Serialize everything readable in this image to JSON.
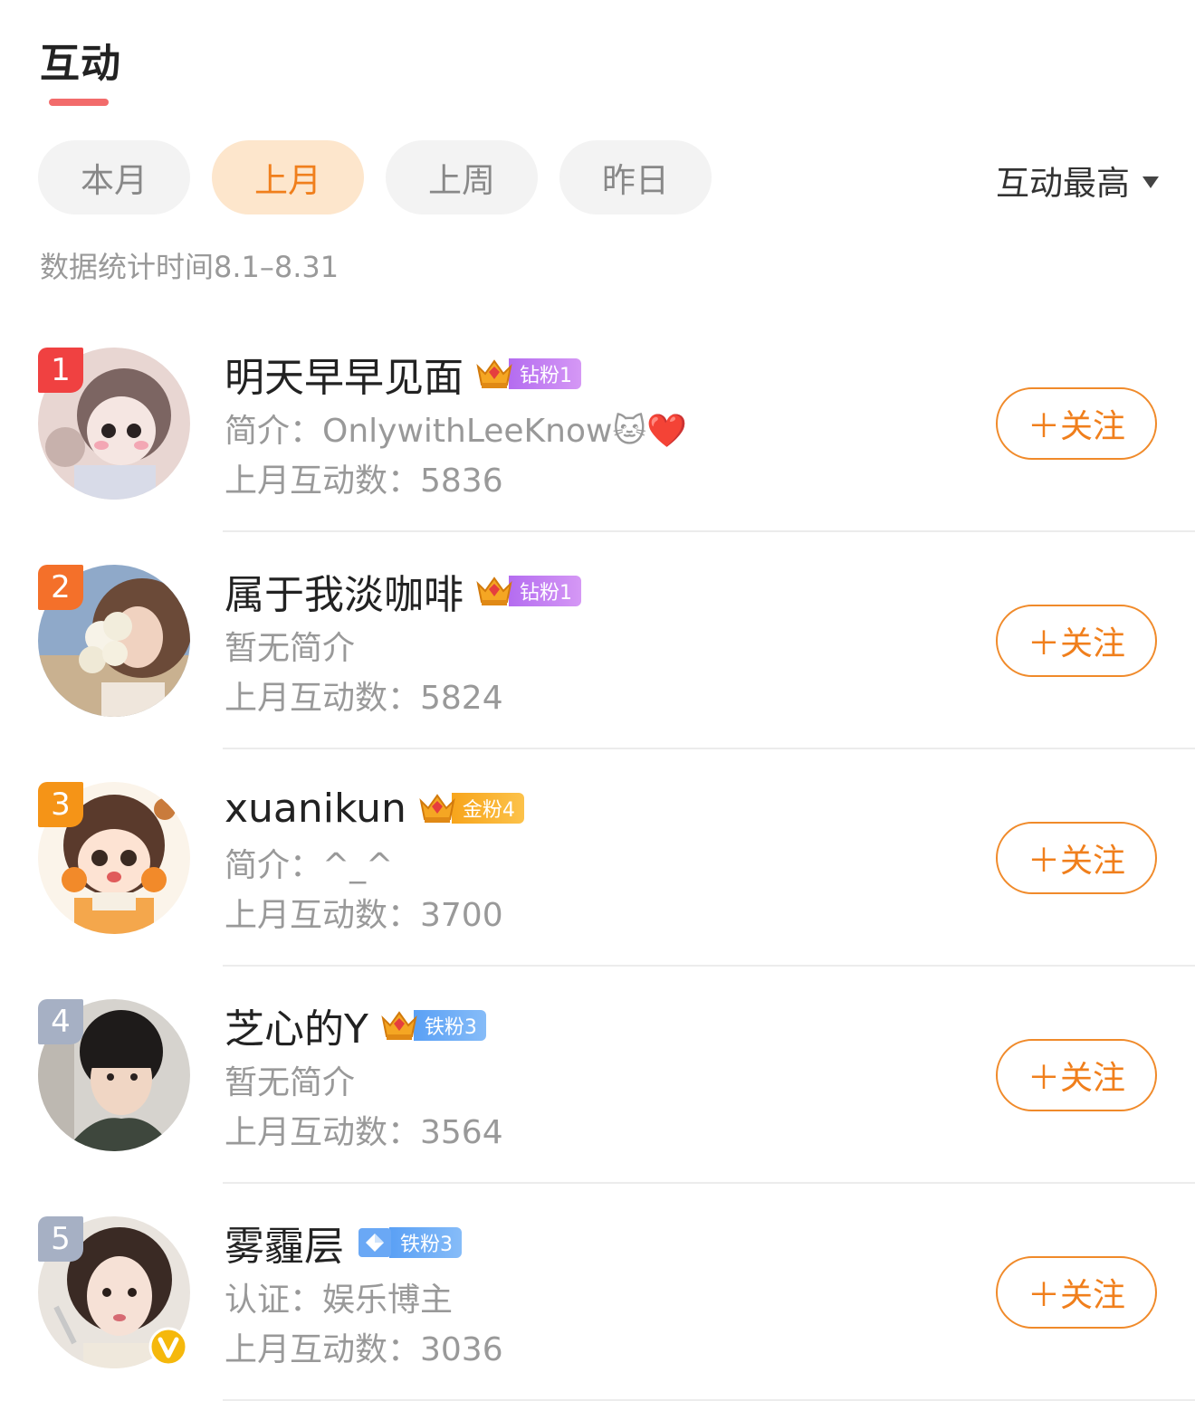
{
  "header": {
    "title": "互动"
  },
  "tabs": [
    {
      "label": "本月",
      "active": false
    },
    {
      "label": "上月",
      "active": true
    },
    {
      "label": "上周",
      "active": false
    },
    {
      "label": "昨日",
      "active": false
    }
  ],
  "sort": {
    "label": "互动最高",
    "icon": "caret-down-icon"
  },
  "stat_time": "数据统计时间8.1–8.31",
  "colors": {
    "accent": "#f07f1c",
    "title_underline": "#f26b6b",
    "rank1": "#f04141",
    "rank2": "#f4702a",
    "rank3": "#f59417",
    "rank_other": "#a6b0c4"
  },
  "users": [
    {
      "rank": "1",
      "name": "明天早早见面",
      "fan_badge": "钻粉1",
      "crown_level": "7",
      "bio": "简介：OnlywithLeeKnow🐱❤️",
      "count": "上月互动数：5836",
      "follow": "＋关注"
    },
    {
      "rank": "2",
      "name": "属于我淡咖啡",
      "fan_badge": "钻粉1",
      "crown_level": "5",
      "bio": "暂无简介",
      "count": "上月互动数：5824",
      "follow": "＋关注"
    },
    {
      "rank": "3",
      "name": "xuanikun",
      "fan_badge": "金粉4",
      "crown_level": "4",
      "bio": "简介：^_^",
      "count": "上月互动数：3700",
      "follow": "＋关注"
    },
    {
      "rank": "4",
      "name": "芝心的Y",
      "fan_badge": "铁粉3",
      "crown_level": "3",
      "bio": "暂无简介",
      "count": "上月互动数：3564",
      "follow": "＋关注"
    },
    {
      "rank": "5",
      "name": "雾霾层",
      "fan_badge": "铁粉3",
      "crown_level": "",
      "bio": "认证：娱乐博主",
      "count": "上月互动数：3036",
      "follow": "＋关注"
    }
  ]
}
